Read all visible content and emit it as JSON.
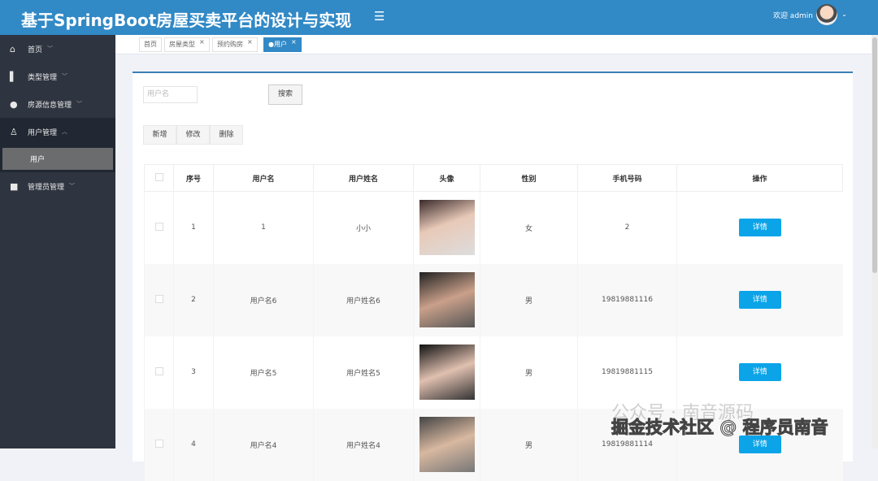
{
  "header": {
    "title": "基于SpringBoot房屋买卖平台的设计与实现",
    "menu_icon": "☰",
    "welcome": "欢迎 admin",
    "chevron": "⌄"
  },
  "sidebar": {
    "items": [
      {
        "label": "首页",
        "icon": "⌂",
        "chev": "﹀"
      },
      {
        "label": "类型管理",
        "icon": "▌",
        "chev": "﹀"
      },
      {
        "label": "房源信息管理",
        "icon": "●",
        "chev": "﹀"
      },
      {
        "label": "用户管理",
        "icon": "♙",
        "chev": "︿"
      },
      {
        "label": "管理员管理",
        "icon": "■",
        "chev": "﹀"
      }
    ],
    "sub": "用户"
  },
  "tabs": [
    {
      "label": "首页"
    },
    {
      "label": "房屋类型",
      "close": "×"
    },
    {
      "label": "预约购房",
      "close": "×"
    },
    {
      "label": "●用户",
      "close": "×"
    }
  ],
  "search": {
    "placeholder": "用户名",
    "button": "搜索"
  },
  "actions": {
    "add": "新增",
    "edit": "修改",
    "delete": "删除"
  },
  "table": {
    "headers": [
      "序号",
      "用户名",
      "用户姓名",
      "头像",
      "性别",
      "手机号码",
      "操作"
    ],
    "rows": [
      {
        "no": "1",
        "username": "1",
        "name": "小小",
        "gender": "女",
        "phone": "2",
        "action": "详情"
      },
      {
        "no": "2",
        "username": "用户名6",
        "name": "用户姓名6",
        "gender": "男",
        "phone": "19819881116",
        "action": "详情"
      },
      {
        "no": "3",
        "username": "用户名5",
        "name": "用户姓名5",
        "gender": "男",
        "phone": "19819881115",
        "action": "详情"
      },
      {
        "no": "4",
        "username": "用户名4",
        "name": "用户姓名4",
        "gender": "男",
        "phone": "19819881114",
        "action": "详情"
      }
    ]
  },
  "watermark": {
    "line1": "公众号 · 南音源码",
    "line2": "掘金技术社区 @ 程序员南音"
  }
}
